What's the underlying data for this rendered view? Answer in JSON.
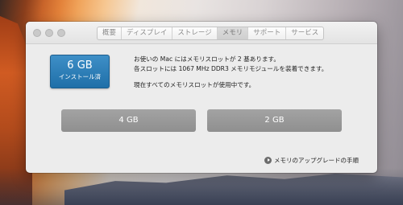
{
  "tabs": [
    "概要",
    "ディスプレイ",
    "ストレージ",
    "メモリ",
    "サポート",
    "サービス"
  ],
  "active_tab": "メモリ",
  "memory": {
    "installed_size": "6 GB",
    "installed_label": "インストール済"
  },
  "info": {
    "line1": "お使いの Mac にはメモリスロットが 2 基あります。",
    "line2": "各スロットには 1067 MHz DDR3 メモリモジュールを装着できます。",
    "line3": "現在すべてのメモリスロットが使用中です。"
  },
  "slots": [
    "4 GB",
    "2 GB"
  ],
  "upgrade_link": "メモリのアップグレードの手順",
  "colors": {
    "badge": "#2a7cb8",
    "slot": "#9a9a9a"
  }
}
